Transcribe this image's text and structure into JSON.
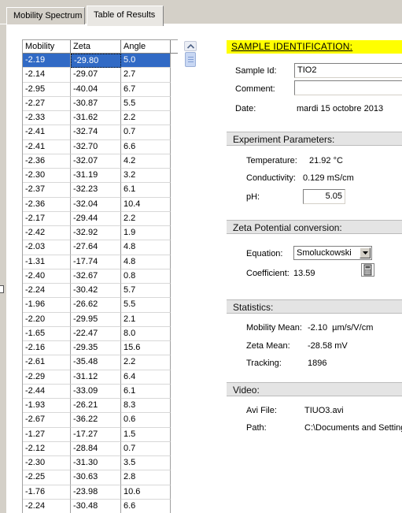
{
  "tabs": [
    {
      "label": "Mobility Spectrum",
      "active": false
    },
    {
      "label": "Table of Results",
      "active": true
    }
  ],
  "table": {
    "headers": [
      "Mobility",
      "Zeta",
      "Angle"
    ],
    "rows": [
      [
        "-2.19",
        "-29.80",
        "5.0"
      ],
      [
        "-2.14",
        "-29.07",
        "2.7"
      ],
      [
        "-2.95",
        "-40.04",
        "6.7"
      ],
      [
        "-2.27",
        "-30.87",
        "5.5"
      ],
      [
        "-2.33",
        "-31.62",
        "2.2"
      ],
      [
        "-2.41",
        "-32.74",
        "0.7"
      ],
      [
        "-2.41",
        "-32.70",
        "6.6"
      ],
      [
        "-2.36",
        "-32.07",
        "4.2"
      ],
      [
        "-2.30",
        "-31.19",
        "3.2"
      ],
      [
        "-2.37",
        "-32.23",
        "6.1"
      ],
      [
        "-2.36",
        "-32.04",
        "10.4"
      ],
      [
        "-2.17",
        "-29.44",
        "2.2"
      ],
      [
        "-2.42",
        "-32.92",
        "1.9"
      ],
      [
        "-2.03",
        "-27.64",
        "4.8"
      ],
      [
        "-1.31",
        "-17.74",
        "4.8"
      ],
      [
        "-2.40",
        "-32.67",
        "0.8"
      ],
      [
        "-2.24",
        "-30.42",
        "5.7"
      ],
      [
        "-1.96",
        "-26.62",
        "5.5"
      ],
      [
        "-2.20",
        "-29.95",
        "2.1"
      ],
      [
        "-1.65",
        "-22.47",
        "8.0"
      ],
      [
        "-2.16",
        "-29.35",
        "15.6"
      ],
      [
        "-2.61",
        "-35.48",
        "2.2"
      ],
      [
        "-2.29",
        "-31.12",
        "6.4"
      ],
      [
        "-2.44",
        "-33.09",
        "6.1"
      ],
      [
        "-1.93",
        "-26.21",
        "8.3"
      ],
      [
        "-2.67",
        "-36.22",
        "0.6"
      ],
      [
        "-1.27",
        "-17.27",
        "1.5"
      ],
      [
        "-2.12",
        "-28.84",
        "0.7"
      ],
      [
        "-2.30",
        "-31.30",
        "3.5"
      ],
      [
        "-2.25",
        "-30.63",
        "2.8"
      ],
      [
        "-1.76",
        "-23.98",
        "10.6"
      ],
      [
        "-2.24",
        "-30.48",
        "6.6"
      ]
    ]
  },
  "sample": {
    "heading": "SAMPLE IDENTIFICATION:",
    "id_label": "Sample Id:",
    "id_value": "TIO2",
    "comment_label": "Comment:",
    "comment_value": "",
    "date_label": "Date:",
    "date_value": "mardi 15 octobre 2013"
  },
  "experiment": {
    "heading": "Experiment Parameters:",
    "temperature_label": "Temperature:",
    "temperature_value": "21.92 °C",
    "conductivity_label": "Conductivity:",
    "conductivity_value": "0.129 mS/cm",
    "ph_label": "pH:",
    "ph_value": "5.05"
  },
  "zeta": {
    "heading": "Zeta Potential conversion:",
    "equation_label": "Equation:",
    "equation_value": "Smoluckowski",
    "coefficient_label": "Coefficient:",
    "coefficient_value": "13.59"
  },
  "statistics": {
    "heading": "Statistics:",
    "mobility_label": "Mobility Mean:",
    "mobility_value": "-2.10  µm/s/V/cm",
    "zeta_label": "Zeta Mean:",
    "zeta_value": "-28.58 mV",
    "tracking_label": "Tracking:",
    "tracking_value": "1896"
  },
  "video": {
    "heading": "Video:",
    "avi_label": "Avi File:",
    "avi_value": "TIUO3.avi",
    "path_label": "Path:",
    "path_value": "C:\\Documents and Settings"
  },
  "colors": {
    "selection": "#316ac5",
    "section_highlight": "#ffff00",
    "section_header": "#e4e4e4"
  }
}
